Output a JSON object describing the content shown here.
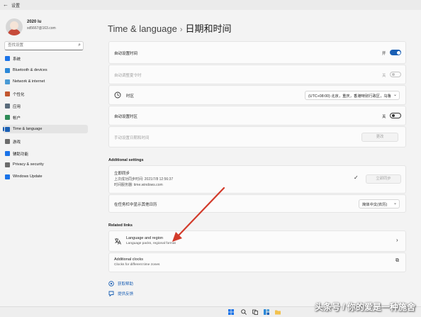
{
  "window": {
    "title": "设置",
    "back_glyph": "←"
  },
  "profile": {
    "name": "2020 lu",
    "email": "xd5667@163.com"
  },
  "search": {
    "placeholder": "查找设置"
  },
  "nav": [
    {
      "label": "系统",
      "icon": "monitor-icon",
      "color": "#1a73e8"
    },
    {
      "label": "Bluetooth & devices",
      "icon": "bluetooth-icon",
      "color": "#2b88d8"
    },
    {
      "label": "Network & internet",
      "icon": "wifi-icon",
      "color": "#4a9ad4"
    },
    {
      "label": "个性化",
      "icon": "brush-icon",
      "color": "#c2572f"
    },
    {
      "label": "应用",
      "icon": "apps-icon",
      "color": "#5a6b7b"
    },
    {
      "label": "帐户",
      "icon": "person-icon",
      "color": "#2e8b57"
    },
    {
      "label": "Time & language",
      "icon": "clock-globe-icon",
      "color": "#1a5fb4",
      "active": true
    },
    {
      "label": "游戏",
      "icon": "gamepad-icon",
      "color": "#6b6b6b"
    },
    {
      "label": "辅助功能",
      "icon": "accessibility-icon",
      "color": "#1a73e8"
    },
    {
      "label": "Privacy & security",
      "icon": "shield-icon",
      "color": "#6b6b6b"
    },
    {
      "label": "Windows Update",
      "icon": "update-icon",
      "color": "#1a73e8"
    }
  ],
  "page": {
    "crumb": "Time & language",
    "separator": "›",
    "title": "日期和时间"
  },
  "settings": {
    "auto_time": {
      "label": "自动设置时间",
      "state": "开"
    },
    "auto_dst": {
      "label": "自动调整夏令时",
      "state": "关"
    },
    "timezone": {
      "label": "时区",
      "value": "(UTC+08:00) 北京，重庆，香港特别行政区，乌鲁",
      "chevron": "⌄"
    },
    "auto_tz": {
      "label": "自动设置时区",
      "state": "关"
    },
    "manual": {
      "label": "手动设置日期和时间",
      "button": "更改"
    }
  },
  "additional": {
    "heading": "Additional settings",
    "sync": {
      "label": "立即同步",
      "last": "上次成功同步时间: 2021/7/8 12:56:37",
      "server": "时间服务器: time.windows.com",
      "check": "✓",
      "button": "立即同步"
    },
    "calendar": {
      "label": "在任务栏中显示其他日历",
      "value": "简体中文(农历)",
      "chevron": "⌄"
    }
  },
  "related": {
    "heading": "Related links",
    "lang": {
      "title": "Language and region",
      "subtitle": "Language packs, regional format",
      "chevron": "›"
    },
    "clocks": {
      "title": "Additional clocks",
      "subtitle": "Clocks for different time zones",
      "external": "⧉"
    }
  },
  "footer": {
    "help": "获取帮助",
    "feedback": "提供反馈"
  },
  "watermark": "头条号 / 你的爱是一种施舍",
  "colors": {
    "accent": "#1a5fb4",
    "arrow": "#d23a2a"
  }
}
